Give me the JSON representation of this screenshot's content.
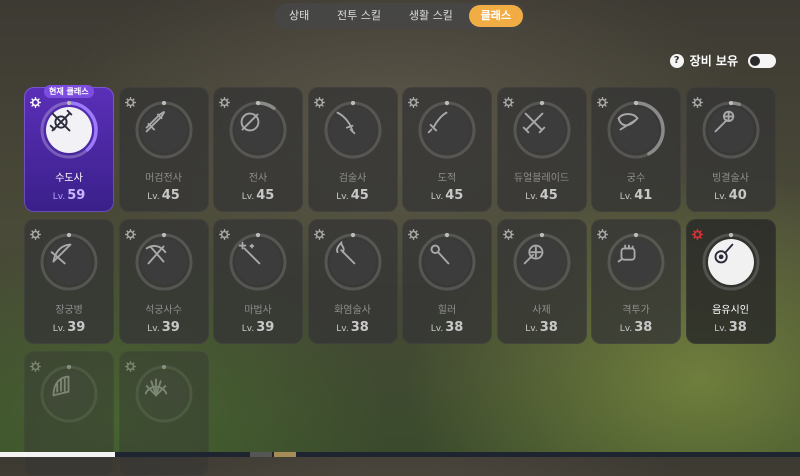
{
  "tabs": [
    {
      "label": "상태",
      "active": false
    },
    {
      "label": "전투 스킬",
      "active": false
    },
    {
      "label": "생활 스킬",
      "active": false
    },
    {
      "label": "클래스",
      "active": true
    }
  ],
  "equip": {
    "help": "?",
    "label": "장비 보유",
    "toggle_on": false
  },
  "current_badge": "현재 클래스",
  "lv_prefix": "Lv.",
  "colors": {
    "accent": "#f1ad43",
    "active_card": "#5b2fb8",
    "level_active": "#c8b6ff",
    "gear_warning": "#e0353b"
  },
  "classes": [
    {
      "name": "수도사",
      "level": "59",
      "icon": "monk-icon",
      "state": "active",
      "progress": 0.38
    },
    {
      "name": "머검전사",
      "level": "45",
      "icon": "greatsword-warrior-icon",
      "state": "locked",
      "progress": 0.0
    },
    {
      "name": "전사",
      "level": "45",
      "icon": "warrior-icon",
      "state": "locked",
      "progress": 0.1
    },
    {
      "name": "검술사",
      "level": "45",
      "icon": "swordsman-icon",
      "state": "locked",
      "progress": 0.0
    },
    {
      "name": "도적",
      "level": "45",
      "icon": "rogue-icon",
      "state": "locked",
      "progress": 0.0
    },
    {
      "name": "듀얼블레이드",
      "level": "45",
      "icon": "dual-blade-icon",
      "state": "locked",
      "progress": 0.0
    },
    {
      "name": "궁수",
      "level": "41",
      "icon": "archer-icon",
      "state": "locked",
      "progress": 0.42
    },
    {
      "name": "빙결술사",
      "level": "40",
      "icon": "ice-mage-icon",
      "state": "locked",
      "progress": 0.05
    },
    {
      "name": "장궁병",
      "level": "39",
      "icon": "longbow-icon",
      "state": "locked",
      "progress": 0.0
    },
    {
      "name": "석궁사수",
      "level": "39",
      "icon": "crossbow-icon",
      "state": "locked",
      "progress": 0.0
    },
    {
      "name": "마법사",
      "level": "39",
      "icon": "mage-icon",
      "state": "locked",
      "progress": 0.0
    },
    {
      "name": "화염술사",
      "level": "38",
      "icon": "fire-mage-icon",
      "state": "locked",
      "progress": 0.0
    },
    {
      "name": "힐러",
      "level": "38",
      "icon": "healer-icon",
      "state": "locked",
      "progress": 0.0
    },
    {
      "name": "사제",
      "level": "38",
      "icon": "priest-icon",
      "state": "locked",
      "progress": 0.0
    },
    {
      "name": "격투가",
      "level": "38",
      "icon": "fighter-icon",
      "state": "locked",
      "progress": 0.0
    },
    {
      "name": "음유시인",
      "level": "38",
      "icon": "bard-icon",
      "state": "bright",
      "progress": 0.0
    },
    {
      "name": "",
      "level": "",
      "icon": "harp-icon",
      "state": "faded",
      "progress": 0.0
    },
    {
      "name": "",
      "level": "",
      "icon": "dancer-fan-icon",
      "state": "faded",
      "progress": 0.0
    }
  ]
}
